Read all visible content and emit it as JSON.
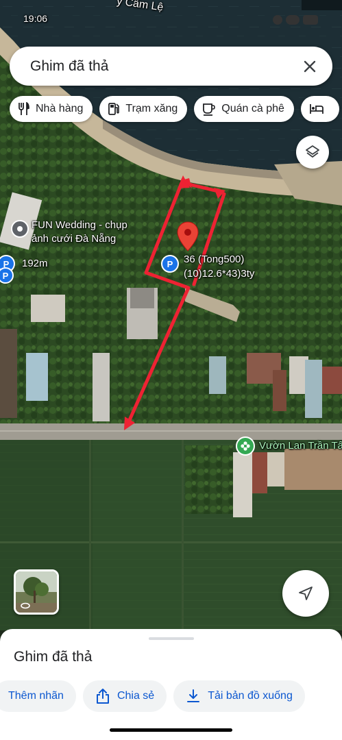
{
  "status_bar": {
    "time": "19:06"
  },
  "search": {
    "query": "Ghim đã thả"
  },
  "chips": [
    {
      "label": "Nhà hàng",
      "icon": "fork-knife-icon"
    },
    {
      "label": "Trạm xăng",
      "icon": "gas-station-icon"
    },
    {
      "label": "Quán cà phê",
      "icon": "coffee-cup-icon"
    },
    {
      "label": "",
      "icon": "bed-icon"
    }
  ],
  "map": {
    "river_label": "y Cẩm Lệ",
    "poi_wedding": {
      "name_line1": "FUN Wedding - chụp",
      "name_line2": "ảnh cưới Đà Nẵng",
      "icon": "location-pin-icon"
    },
    "poi_parking_1": {
      "distance": "192m",
      "icon": "parking-icon"
    },
    "poi_parking_2": {
      "name_line1": "36 (Tong500)",
      "name_line2": "(10)12.6*43)3ty",
      "icon": "parking-icon"
    },
    "poi_garden": {
      "name": "Vườn Lan Trần Tấ",
      "icon": "flower-icon",
      "color": "#34a853"
    },
    "dropped_pin_color": "#ea4335",
    "annotation_color": "#ee2233"
  },
  "bottom_sheet": {
    "title": "Ghim đã thả",
    "actions": [
      {
        "label": "Thêm nhãn",
        "icon": "label-icon"
      },
      {
        "label": "Chia sẻ",
        "icon": "share-icon"
      },
      {
        "label": "Tải bản đồ xuống",
        "icon": "download-icon"
      }
    ]
  },
  "colors": {
    "accent": "#0b57d0",
    "text": "#202124",
    "parking_blue": "#1a73e8"
  }
}
